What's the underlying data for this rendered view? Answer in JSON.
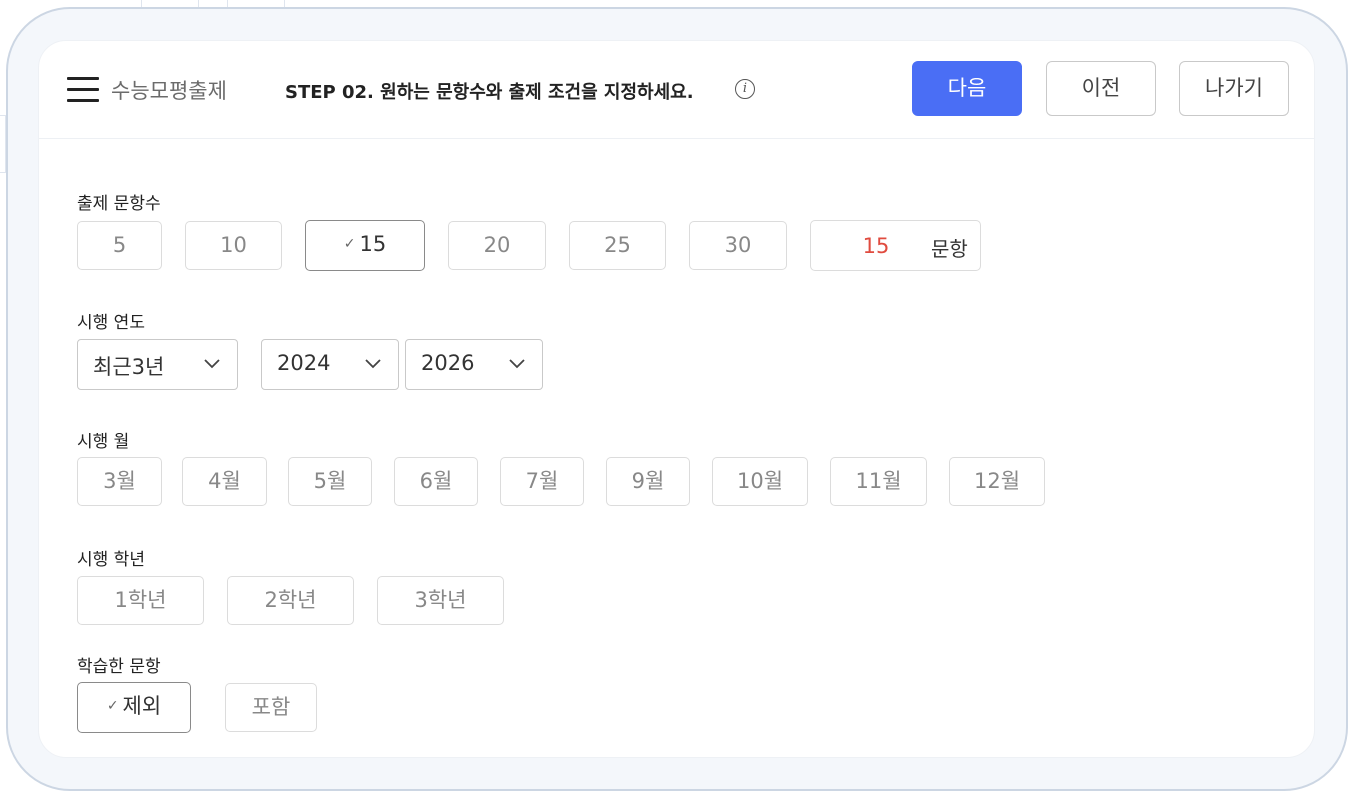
{
  "header": {
    "app_title": "수능모평출제",
    "step_title": "STEP 02. 원하는 문항수와 출제 조건을 지정하세요.",
    "info_icon": "i",
    "next_label": "다음",
    "prev_label": "이전",
    "exit_label": "나가기"
  },
  "colors": {
    "primary": "#4a6ef5",
    "count_value": "#e04b3f"
  },
  "question_count": {
    "label": "출제 문항수",
    "options": [
      "5",
      "10",
      "15",
      "20",
      "25",
      "30"
    ],
    "selected": "15",
    "custom_value": "15",
    "custom_unit": "문항"
  },
  "exam_year": {
    "label": "시행 연도",
    "range_preset": "최근3년",
    "start_year": "2024",
    "end_year": "2026"
  },
  "exam_month": {
    "label": "시행 월",
    "options": [
      "3월",
      "4월",
      "5월",
      "6월",
      "7월",
      "9월",
      "10월",
      "11월",
      "12월"
    ]
  },
  "exam_grade": {
    "label": "시행 학년",
    "options": [
      "1학년",
      "2학년",
      "3학년"
    ]
  },
  "studied_items": {
    "label": "학습한 문항",
    "options": [
      "제외",
      "포함"
    ],
    "selected": "제외"
  }
}
